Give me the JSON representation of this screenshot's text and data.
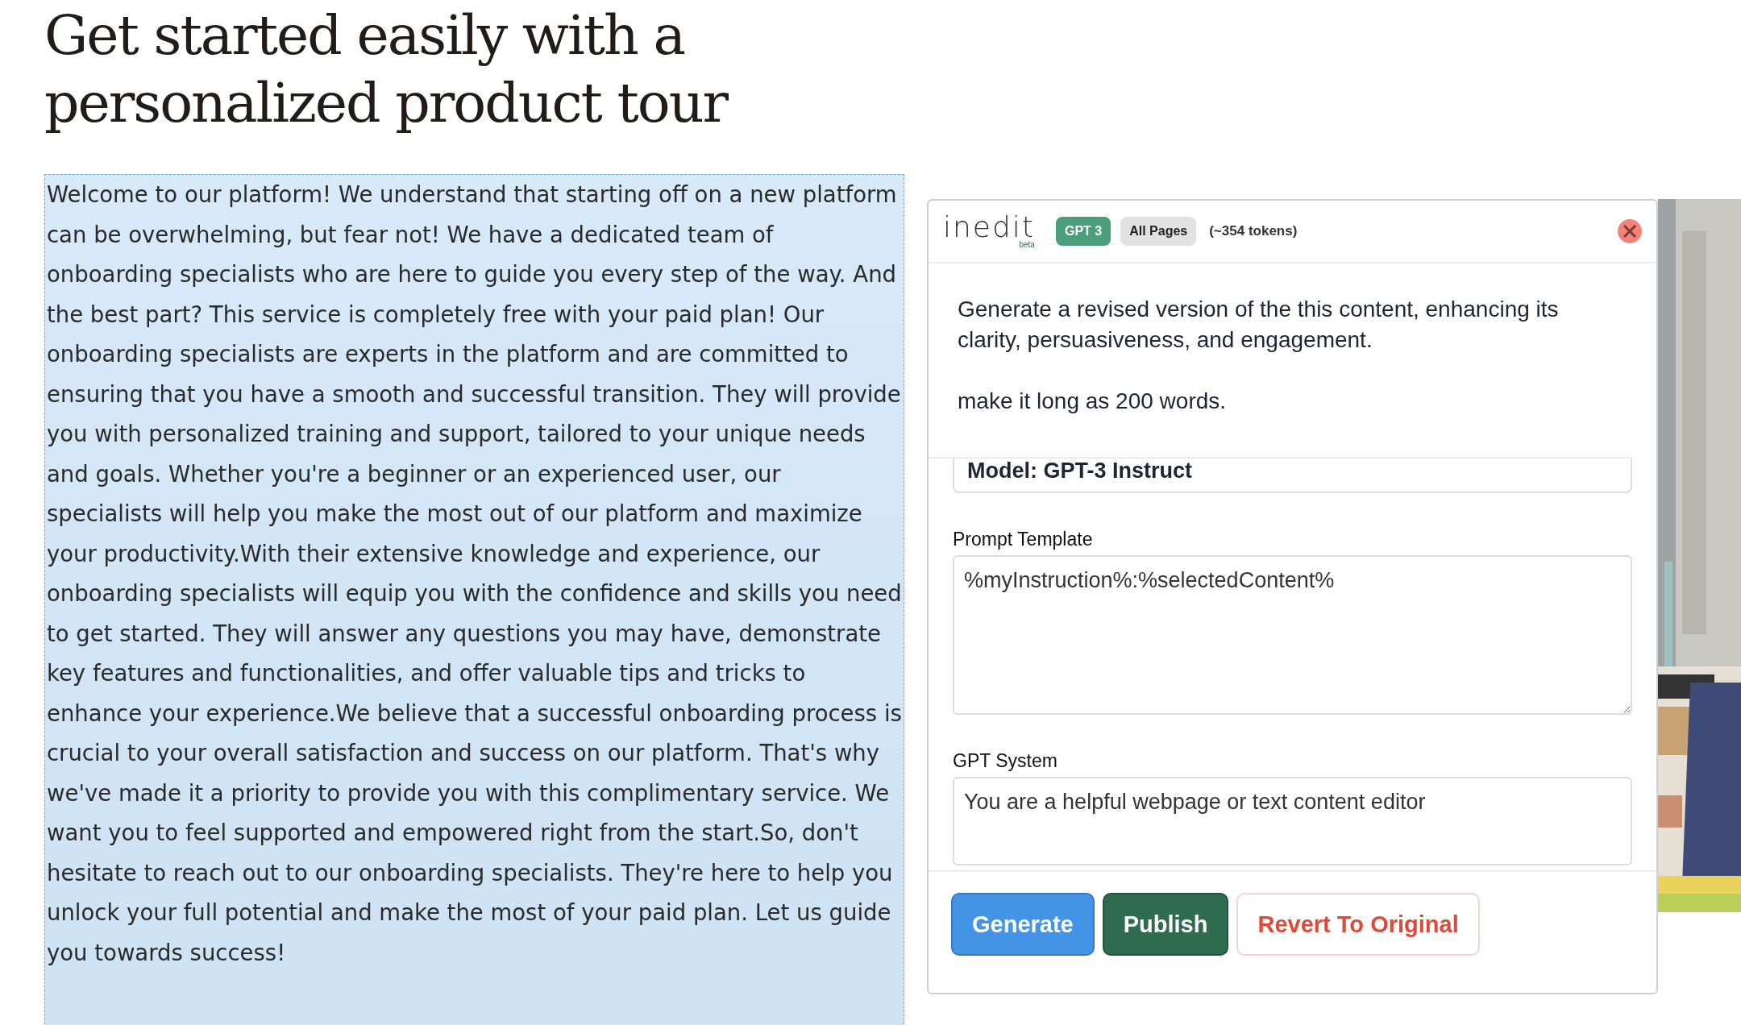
{
  "heading": [
    "Get started easily with a",
    "personalized product tour"
  ],
  "paragraph": "Welcome to our platform! We understand that starting off on a new platform can be overwhelming, but fear not! We have a dedicated team of onboarding specialists who are here to guide you every step of the way. And the best part? This service is completely free with your paid plan! Our onboarding specialists are experts in the platform and are committed to ensuring that you have a smooth and successful transition. They will provide you with personalized training and support, tailored to your unique needs and goals. Whether you're a beginner or an experienced user, our specialists will help you make the most out of our platform and maximize your productivity.With their extensive knowledge and experience, our onboarding specialists will equip you with the confidence and skills you need to get started. They will answer any questions you may have, demonstrate key features and functionalities, and offer valuable tips and tricks to enhance your experience.We believe that a successful onboarding process is crucial to your overall satisfaction and success on our platform. That's why we've made it a priority to provide you with this complimentary service. We want you to feel supported and empowered right from the start.So, don't hesitate to reach out to our onboarding specialists. They're here to help you unlock your full potential and make the most of your paid plan. Let us guide you towards success!",
  "panel": {
    "logo": "inedit",
    "logo_sub": "beta",
    "badges": [
      {
        "label": "GPT 3",
        "kind": "model"
      },
      {
        "label": "All Pages",
        "kind": "scope"
      }
    ],
    "tokens": "(~354 tokens)",
    "instruction": "Generate a revised version of the this content, enhancing its clarity, persuasiveness, and engagement.\n\nmake it long as 200 words.",
    "model": "Model: GPT-3 Instruct",
    "fields": [
      {
        "label": "Prompt Template",
        "value": "%myInstruction%:%selectedContent%",
        "kind": "tall"
      },
      {
        "label": "GPT System",
        "value": "You are a helpful webpage or text content editor",
        "kind": "short"
      }
    ],
    "buttons": [
      {
        "label": "Generate",
        "kind": "primary"
      },
      {
        "label": "Publish",
        "kind": "success"
      },
      {
        "label": "Revert To Original",
        "kind": "danger"
      }
    ]
  }
}
